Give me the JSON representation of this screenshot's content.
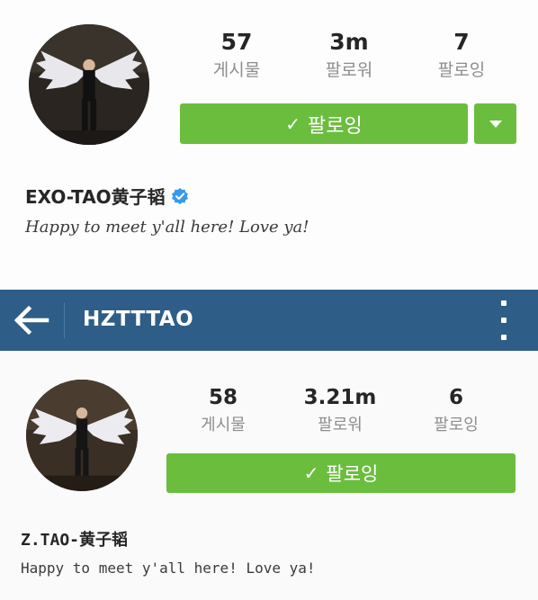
{
  "profile_old": {
    "stats": [
      {
        "value": "57",
        "label": "게시물"
      },
      {
        "value": "3m",
        "label": "팔로워"
      },
      {
        "value": "7",
        "label": "팔로잉"
      }
    ],
    "follow_button": {
      "icon": "check-icon",
      "label": "팔로잉"
    },
    "dropdown_icon": "chevron-down-icon",
    "username": "EXO-TAO黄子韬",
    "verified_icon": "verified-badge-icon",
    "bio": "Happy to meet y'all here! Love ya!"
  },
  "navbar": {
    "back_icon": "arrow-left-icon",
    "title": "HZTTTAO",
    "menu_icon": "more-vertical-icon"
  },
  "profile_new": {
    "stats": [
      {
        "value": "58",
        "label": "게시물"
      },
      {
        "value": "3.21m",
        "label": "팔로워"
      },
      {
        "value": "6",
        "label": "팔로잉"
      }
    ],
    "follow_button": {
      "icon": "check-icon",
      "label": "팔로잉"
    },
    "username": "Z.TAO-黄子韬",
    "bio": "Happy to meet y'all here! Love ya!"
  },
  "colors": {
    "follow_green": "#6bbd3e",
    "navbar_blue": "#2e5e87",
    "verified_blue": "#3897f0"
  }
}
